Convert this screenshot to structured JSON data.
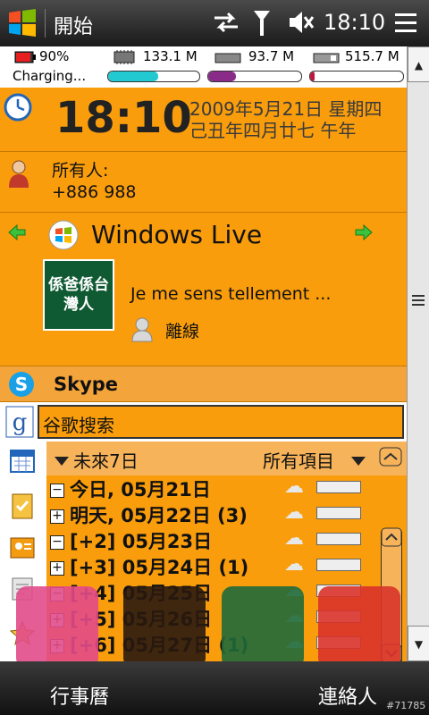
{
  "topbar": {
    "title": "開始",
    "time": "18:10",
    "icons": [
      "windows-logo",
      "sync-arrows",
      "signal",
      "speaker-muted",
      "menu-lines"
    ]
  },
  "status": {
    "battery_pct": "90%",
    "battery_text": "Charging...",
    "mem1": "133.1 M",
    "mem2": "93.7 M",
    "mem3": "515.7 M",
    "mem1_level": 0.55,
    "mem2_level": 0.3,
    "mem3_level": 0.05,
    "colors": {
      "mem1": "#22c9d0",
      "mem2": "#8a2b8a",
      "mem3": "#c4143c"
    }
  },
  "clock": {
    "time": "18:10",
    "date_line1": "2009年5月21日 星期四",
    "date_line2": "己丑年四月廿七 午年"
  },
  "owner": {
    "label": "所有人:",
    "phone": "+886 988"
  },
  "windows_live": {
    "title": "Windows Live",
    "avatar_text": "係爸係台灣人",
    "status_text": "Je me sens tellement ...",
    "presence": "離線"
  },
  "skype": {
    "label": "Skype"
  },
  "google": {
    "value": "谷歌搜索"
  },
  "calendar": {
    "filter": "未來7日",
    "scope": "所有項目",
    "rows": [
      {
        "toggle": "−",
        "text": "今日, 05月21日"
      },
      {
        "toggle": "+",
        "text": "明天, 05月22日 (3)"
      },
      {
        "toggle": "−",
        "text": "[+2] 05月23日"
      },
      {
        "toggle": "+",
        "text": "[+3] 05月24日 (1)"
      },
      {
        "toggle": "−",
        "text": "[+4] 05月25日"
      },
      {
        "toggle": "+",
        "text": "[+5] 05月26日"
      },
      {
        "toggle": "+",
        "text": "[+6] 05月27日 (1)"
      }
    ]
  },
  "bottombar": {
    "left": "行事曆",
    "right": "連絡人"
  },
  "watermark": "#71785"
}
